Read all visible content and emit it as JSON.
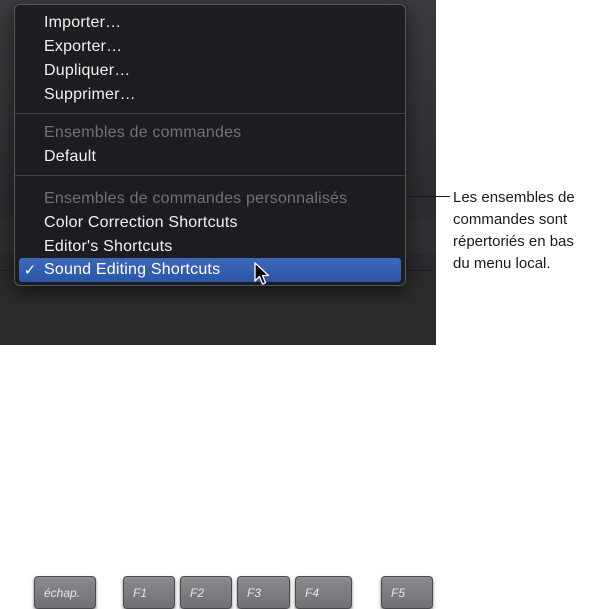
{
  "menu": {
    "items_top": [
      {
        "label": "Importer…"
      },
      {
        "label": "Exporter…"
      },
      {
        "label": "Dupliquer…"
      },
      {
        "label": "Supprimer…"
      }
    ],
    "section_commands_header": "Ensembles de commandes",
    "default_label": "Default",
    "section_custom_header": "Ensembles de commandes personnalisés",
    "custom_items": [
      {
        "label": "Color Correction Shortcuts"
      },
      {
        "label": "Editor's Shortcuts"
      },
      {
        "label": "Sound Editing Shortcuts",
        "checked": true
      }
    ],
    "check_glyph": "✓"
  },
  "keyboard": {
    "keys": [
      "échap.",
      "F1",
      "F2",
      "F3",
      "F4",
      "F5"
    ]
  },
  "callout": {
    "lines": [
      "Les ensembles de",
      "commandes sont",
      "répertoriés en bas",
      "du menu local."
    ]
  },
  "colors": {
    "selection": "#2f5aab",
    "menu_bg": "#1c1d20",
    "disabled_text": "#707276"
  }
}
